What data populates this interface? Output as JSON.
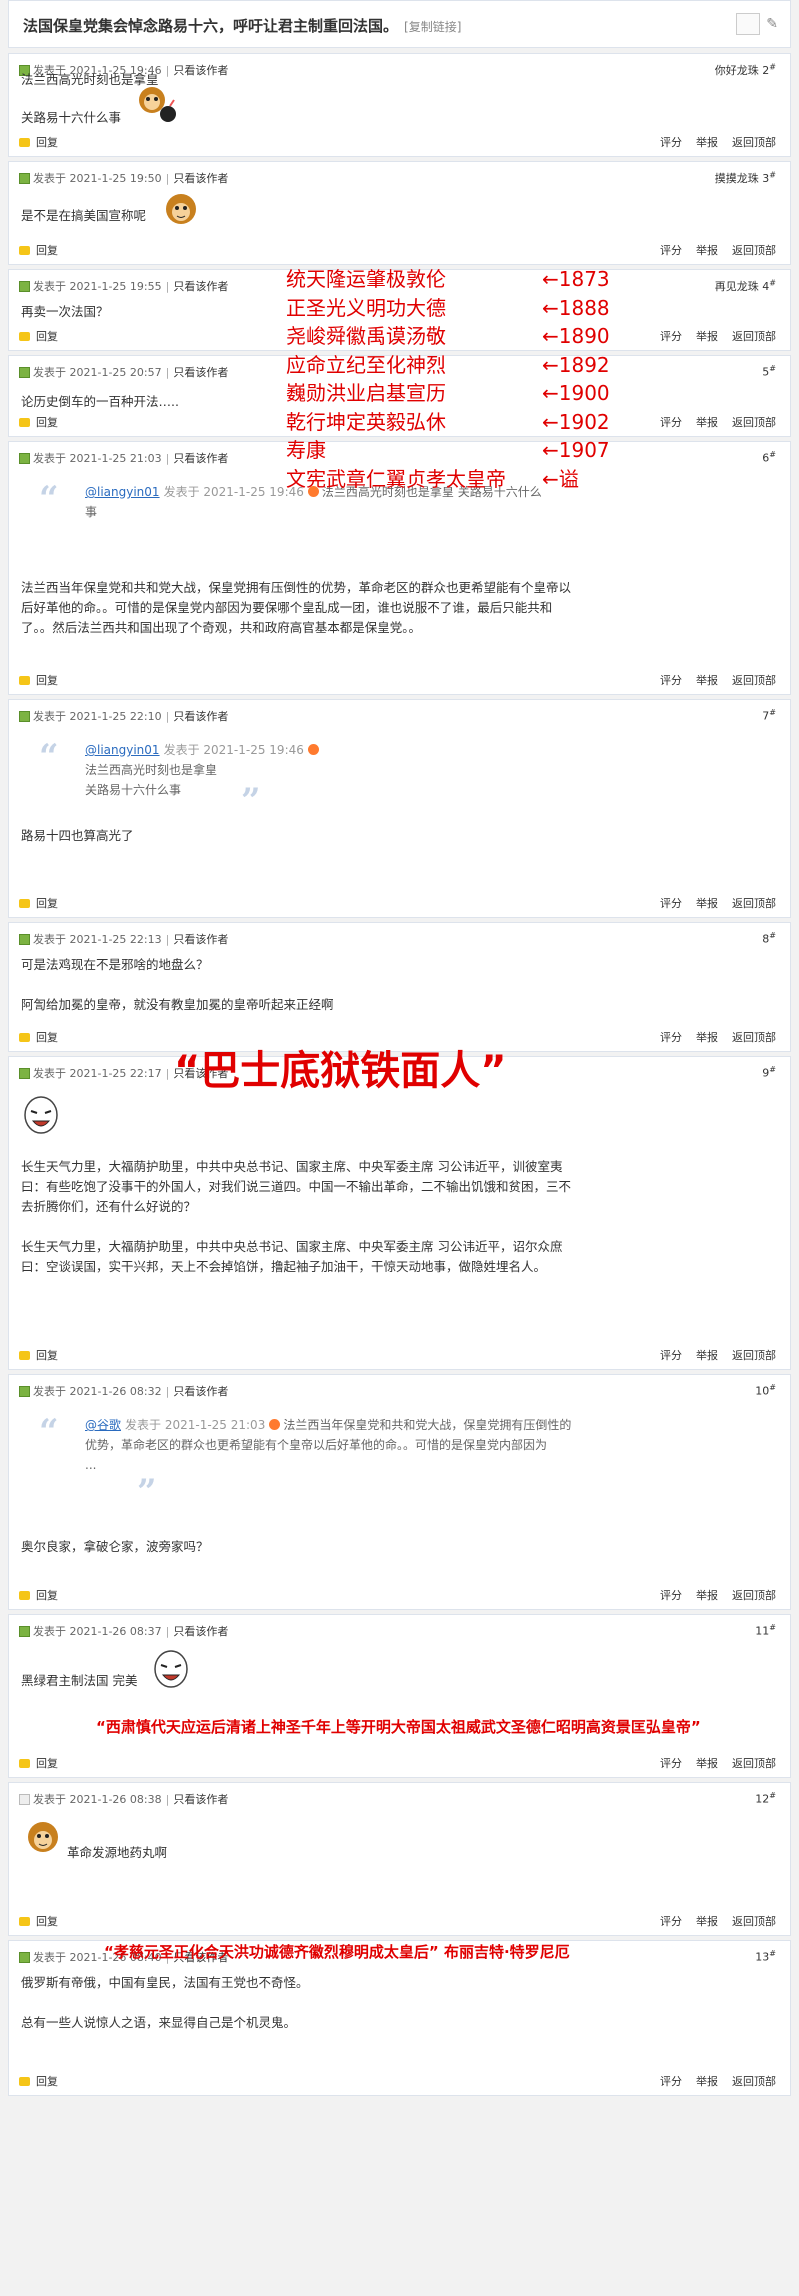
{
  "thread": {
    "title": "法国保皇党集会悼念路易十六，呼吁让君主制重回法国。",
    "copy_link": "[复制链接]"
  },
  "labels": {
    "posted_at": "发表于",
    "only_author": "只看该作者",
    "reply": "回复",
    "rate": "评分",
    "report": "举报",
    "top": "返回顶部"
  },
  "posts": [
    {
      "floor": "2",
      "time": "2021-1-25 19:46",
      "nick": "你好龙珠",
      "lines": [
        "法兰西高光时刻也是拿皇",
        "关路易十六什么事"
      ]
    },
    {
      "floor": "3",
      "time": "2021-1-25 19:50",
      "nick": "摸摸龙珠",
      "lines": [
        "是不是在搞美国宣称呢"
      ]
    },
    {
      "floor": "4",
      "time": "2021-1-25 19:55",
      "nick": "再见龙珠",
      "lines": [
        "再卖一次法国？"
      ]
    },
    {
      "floor": "5",
      "time": "2021-1-25 20:57",
      "nick": "",
      "lines": [
        "论历史倒车的一百种开法….."
      ]
    },
    {
      "floor": "6",
      "time": "2021-1-25 21:03",
      "nick": "",
      "quote": {
        "user": "@liangyin01",
        "time": "发表于 2021-1-25 19:46",
        "text1": "法兰西高光时刻也是拿皇 关路易十六什么",
        "text2": "事"
      },
      "lines": [
        "法兰西当年保皇党和共和党大战，保皇党拥有压倒性的优势，革命老区的群众也更希望能有个皇帝以",
        "后好革他的命。。可惜的是保皇党内部因为要保哪个皇乱成一团，谁也说服不了谁，最后只能共和",
        "了。。然后法兰西共和国出现了个奇观，共和政府高官基本都是保皇党。。"
      ]
    },
    {
      "floor": "7",
      "time": "2021-1-25 22:10",
      "nick": "",
      "quote": {
        "user": "@liangyin01",
        "time": "发表于 2021-1-25 19:46",
        "text1": "法兰西高光时刻也是拿皇",
        "text2": "关路易十六什么事"
      },
      "lines": [
        "路易十四也算高光了"
      ]
    },
    {
      "floor": "8",
      "time": "2021-1-25 22:13",
      "nick": "",
      "lines": [
        "可是法鸡现在不是邪啥的地盘么？",
        "阿訇给加冕的皇帝，就没有教皇加冕的皇帝听起来正经啊"
      ]
    },
    {
      "floor": "9",
      "time": "2021-1-25 22:17",
      "nick": "",
      "lines": [
        "长生天气力里，大福荫护助里，中共中央总书记、国家主席、中央军委主席    习公讳近平，训彼室夷",
        "曰：有些吃饱了没事干的外国人，对我们说三道四。中国一不输出革命，二不输出饥饿和贫困，三不",
        "去折腾你们，还有什么好说的？",
        "长生天气力里，大福荫护助里，中共中央总书记、国家主席、中央军委主席    习公讳近平，诏尔众庶",
        "曰：空谈误国，实干兴邦，天上不会掉馅饼，撸起袖子加油干，干惊天动地事，做隐姓埋名人。"
      ]
    },
    {
      "floor": "10",
      "time": "2021-1-26 08:32",
      "nick": "",
      "quote": {
        "user": "@谷歌",
        "time": "发表于 2021-1-25 21:03",
        "text1": "法兰西当年保皇党和共和党大战，保皇党拥有压倒性的",
        "text2": "优势，革命老区的群众也更希望能有个皇帝以后好革他的命。。可惜的是保皇党内部因为",
        "text3": "..."
      },
      "lines": [
        "奥尔良家，拿破仑家，波旁家吗？"
      ]
    },
    {
      "floor": "11",
      "time": "2021-1-26 08:37",
      "nick": "",
      "lines": [
        "黑绿君主制法国 完美"
      ]
    },
    {
      "floor": "12",
      "time": "2021-1-26 08:38",
      "nick": "",
      "lines": [
        "革命发源地药丸啊"
      ]
    },
    {
      "floor": "13",
      "time": "2021-1-26 08:40",
      "nick": "",
      "lines": [
        "俄罗斯有帝俄，中国有皇民，法国有王党也不奇怪。",
        "总有一些人说惊人之语，来显得自己是个机灵鬼。"
      ]
    }
  ],
  "annotations": {
    "emperors": [
      {
        "name": "统天隆运肇极敦伦",
        "year": "←1873"
      },
      {
        "name": "正圣光义明功大德",
        "year": "←1888"
      },
      {
        "name": "尧峻舜徽禹谟汤敬",
        "year": "←1890"
      },
      {
        "name": "应命立纪至化神烈",
        "year": "←1892"
      },
      {
        "name": "巍勋洪业启基宣历",
        "year": "←1900"
      },
      {
        "name": "乾行坤定英毅弘休",
        "year": "←1902"
      },
      {
        "name": "寿康",
        "year": "←1907"
      },
      {
        "name": "文宪武章仁翼贞孝太皇帝",
        "year": "←谥"
      }
    ],
    "iron_mask": "“巴士底狱铁面人”",
    "post10_red": "“西肃慎代天应运后清诸上神圣千年上等开明大帝国太祖威武文圣德仁昭明高资景匡弘皇帝”",
    "post11_red": "“孝慈元圣正化合天洪功诚德齐徽烈穆明成太皇后” 布丽吉特·特罗尼厄"
  }
}
